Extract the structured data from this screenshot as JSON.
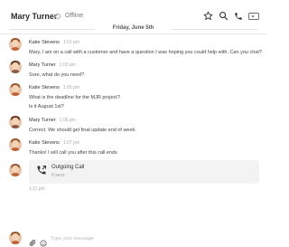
{
  "header": {
    "contact_name": "Mary Turner",
    "status": "Offline",
    "icons": [
      "star-icon",
      "search-icon",
      "phone-icon",
      "video-icon"
    ]
  },
  "date_divider": "Friday, June 5th",
  "messages": [
    {
      "sender": "Katie Stevens",
      "time": "1:01 pm",
      "lines": [
        "Mary, I am on a call with a customer and have a question I was hoping you could help with. Can you chat?"
      ]
    },
    {
      "sender": "Mary Turner",
      "time": "1:03 pm",
      "lines": [
        "Sure, what do you need?"
      ]
    },
    {
      "sender": "Katie Stevens",
      "time": "1:05 pm",
      "lines": [
        "What is the deadline for the MJR project?",
        "Is it August 1st?"
      ]
    },
    {
      "sender": "Mary Turner",
      "time": "1:06 pm",
      "lines": [
        "Correct. We should get final update end of week."
      ]
    },
    {
      "sender": "Katie Stevens",
      "time": "1:07 pm",
      "lines": [
        "Thanks! I will call you after this call ends"
      ]
    }
  ],
  "call": {
    "title": "Outgoing Call",
    "duration": "9 secs",
    "time": "1:11 pm"
  },
  "composer": {
    "placeholder": "Type your message"
  },
  "colors": {
    "accent": "#2d2d2d",
    "card_bg": "#f3f3f3",
    "muted": "#aaaaaa"
  }
}
